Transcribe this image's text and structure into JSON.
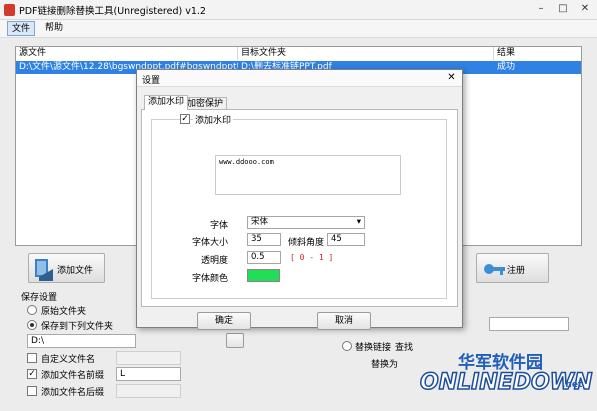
{
  "window": {
    "title": "PDF链接删除替换工具(Unregistered) v1.2"
  },
  "menu": {
    "file": "文件",
    "help": "帮助"
  },
  "table": {
    "headers": [
      "源文件",
      "目标文件夹",
      "结果"
    ],
    "rows": [
      {
        "source": "D:\\文件\\源文件\\12.28\\bgswndppt.pdf#bgswndppt帆洗泺",
        "target": "D:\\删去标准链PPT.pdf",
        "result": "成功"
      }
    ]
  },
  "buttons": {
    "add_file": "添加文件",
    "register": "注册"
  },
  "save": {
    "title": "保存设置",
    "original_folder": "原始文件夹",
    "save_to_folder": "保存到下列文件夹",
    "folder_value": "D:\\",
    "custom_name": "自定义文件名",
    "add_prefix": "添加文件名前缀",
    "prefix_value": "L",
    "add_suffix": "添加文件名后缀"
  },
  "replace": {
    "replace_link": "替换链接",
    "find": "查找",
    "replace_with": "替换为"
  },
  "dialog": {
    "title": "设置",
    "tabs": [
      "添加水印",
      "加密保护"
    ],
    "add_watermark": "添加水印",
    "watermark_text": "www.ddooo.com",
    "font_label": "字体",
    "font_value": "宋体",
    "size_label": "字体大小",
    "size_value": "35",
    "angle_label": "倾斜角度",
    "angle_value": "45",
    "opacity_label": "透明度",
    "opacity_value": "0.5",
    "opacity_range": "[ 0 - 1 ]",
    "color_label": "字体颜色",
    "ok": "确定",
    "cancel": "取消"
  },
  "colors": {
    "font_color": "#22dd55",
    "selection": "#2f82e3"
  },
  "logo": {
    "top": "华军软件园",
    "bottom": "ONLINEDOWN",
    "suffix": ".net"
  }
}
